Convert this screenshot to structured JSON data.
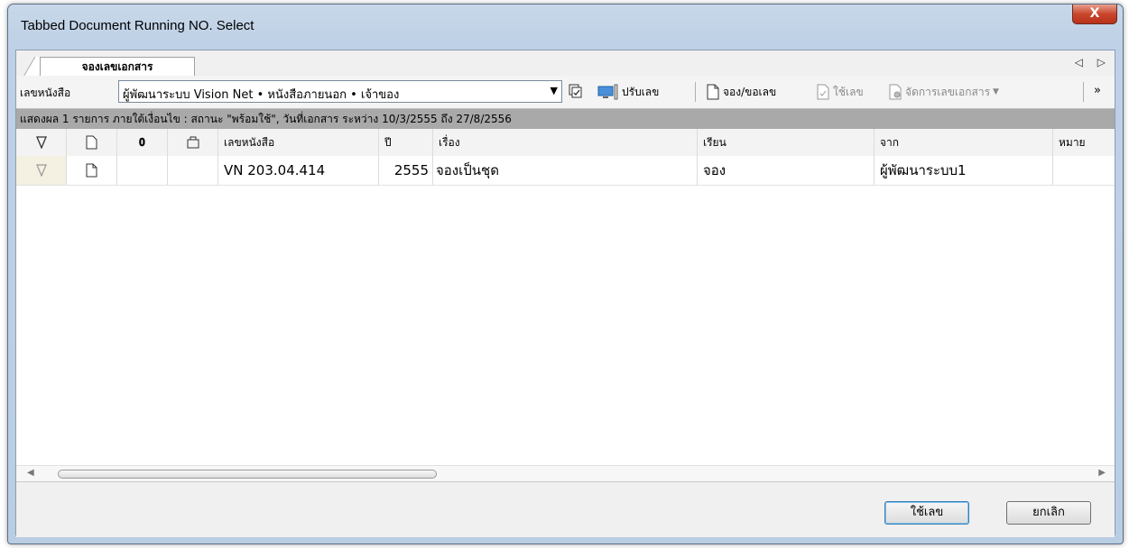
{
  "window": {
    "title": "Tabbed Document Running NO. Select",
    "close_label": "X"
  },
  "tabs": [
    {
      "label": "จองเลขเอกสาร"
    }
  ],
  "tab_scroll": "◁ ▷",
  "toolbar": {
    "book_label": "เลขหนังสือ",
    "book_value": "ผู้พัฒนาระบบ Vision Net • หนังสือภายนอก • เจ้าของ",
    "adjust_label": "ปรับเลข",
    "reserve_label": "จอง/ขอเลข",
    "use_label": "ใช้เลข",
    "manage_label": "จัดการเลขเอกสาร",
    "overflow": "»"
  },
  "status_text": "แสดงผล 1 รายการ ภายใต้เงื่อนไข : สถานะ \"พร้อมใช้\", วันที่เอกสาร ระหว่าง 10/3/2555 ถึง 27/8/2556",
  "columns": {
    "number": "เลขหนังสือ",
    "year": "ปี",
    "subject": "เรื่อง",
    "to": "เรียน",
    "from": "จาก",
    "note": "หมาย"
  },
  "rows": [
    {
      "number": "VN 203.04.414",
      "year": "2555",
      "subject": "จองเป็นชุด",
      "to": "จอง",
      "from": "ผู้พัฒนาระบบ1",
      "note": ""
    }
  ],
  "buttons": {
    "ok": "ใช้เลข",
    "cancel": "ยกเลิก"
  }
}
